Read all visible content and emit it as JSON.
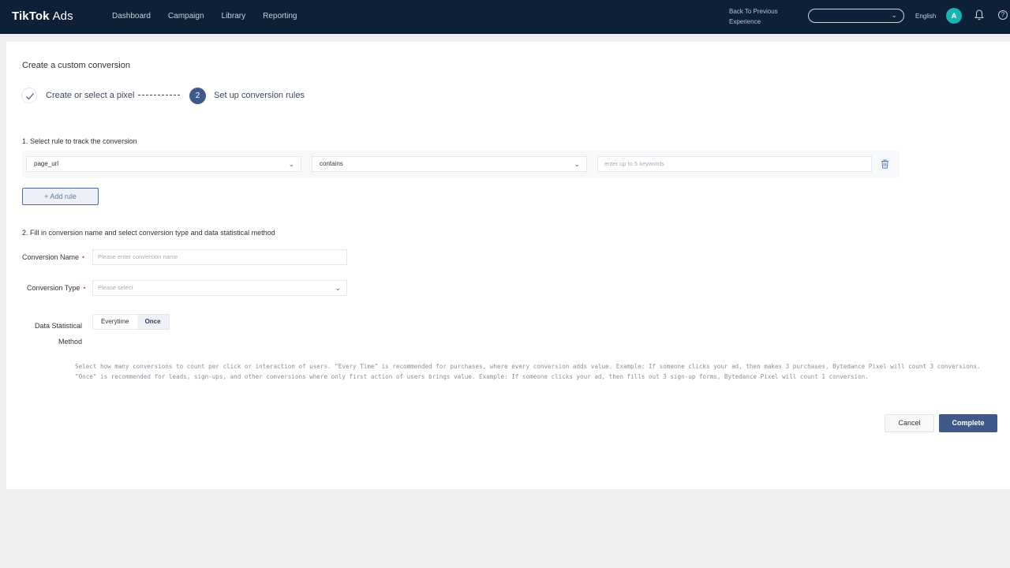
{
  "header": {
    "logo_main": "TikTok",
    "logo_sub": "Ads",
    "nav": [
      "Dashboard",
      "Campaign",
      "Library",
      "Reporting"
    ],
    "back_link": "Back To Previous Experience",
    "search_value": "",
    "language": "English",
    "avatar_initial": "A",
    "help_symbol": "?"
  },
  "page": {
    "title": "Create a custom conversion",
    "steps": {
      "step1_label": "Create or select a pixel",
      "step2_number": "2",
      "step2_label": "Set up conversion rules"
    }
  },
  "rules": {
    "section_title": "1. Select rule to track the conversion",
    "field_value": "page_url",
    "operator_value": "contains",
    "keywords_placeholder": "enter up to 5 keywords",
    "add_rule_label": "+ Add rule"
  },
  "details": {
    "section_title": "2. Fill in conversion name and select conversion type and data statistical method",
    "name_label": "Conversion Name",
    "name_placeholder": "Please enter conversion name",
    "type_label": "Conversion Type",
    "type_placeholder": "Please select",
    "method_label_line1": "Data Statistical",
    "method_label_line2": "Method",
    "method_options": [
      "Everytime",
      "Once"
    ],
    "method_selected": "Once",
    "help_text": "Select how many conversions to count per click or interaction of users.  \"Every Time\" is recommended for purchases, where every conversion adds value. Example: If someone clicks your ad, then makes 3 purchases, Bytedance Pixel will count 3 conversions.  \"Once\" is recommended for leads, sign-ups, and other conversions where only first action of users brings value. Example: If someone clicks your ad, then fills out 3 sign-up forms, Bytedance Pixel will count 1 conversion."
  },
  "actions": {
    "cancel_label": "Cancel",
    "complete_label": "Complete"
  },
  "colors": {
    "header_bg": "#0e1f38",
    "primary": "#3f5a8a",
    "avatar": "#18b3b3",
    "required": "#e8505b"
  }
}
